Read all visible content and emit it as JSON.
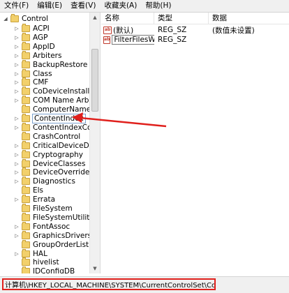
{
  "menu": [
    "文件(F)",
    "编辑(E)",
    "查看(V)",
    "收藏夹(A)",
    "帮助(H)"
  ],
  "tree": {
    "root": "Control",
    "items": [
      "ACPI",
      "AGP",
      "AppID",
      "Arbiters",
      "BackupRestore",
      "Class",
      "CMF",
      "CoDeviceInstallers",
      "COM Name Arbiter",
      "ComputerName",
      "ContentIndex",
      "ContentIndexCommon",
      "CrashControl",
      "CriticalDeviceDatabase",
      "Cryptography",
      "DeviceClasses",
      "DeviceOverrides",
      "Diagnostics",
      "Els",
      "Errata",
      "FileSystem",
      "FileSystemUtilities",
      "FontAssoc",
      "GraphicsDrivers",
      "GroupOrderList",
      "HAL",
      "hivelist",
      "IDConfigDB"
    ],
    "selected": "ContentIndex"
  },
  "list": {
    "headers": {
      "name": "名称",
      "type": "类型",
      "data": "数据"
    },
    "rows": [
      {
        "name": "(默认)",
        "type": "REG_SZ",
        "data": "(数值未设置)"
      },
      {
        "name": "FilterFilesWith...",
        "type": "REG_SZ",
        "data": ""
      }
    ]
  },
  "status": {
    "path": "计算机\\HKEY_LOCAL_MACHINE\\SYSTEM\\CurrentControlSet\\Control\\ContentIndex"
  },
  "colors": {
    "annotation": "#e0201c",
    "folder": "#f2d06b"
  },
  "icons": {
    "folder": "folder-icon",
    "value": "string-value-icon"
  }
}
